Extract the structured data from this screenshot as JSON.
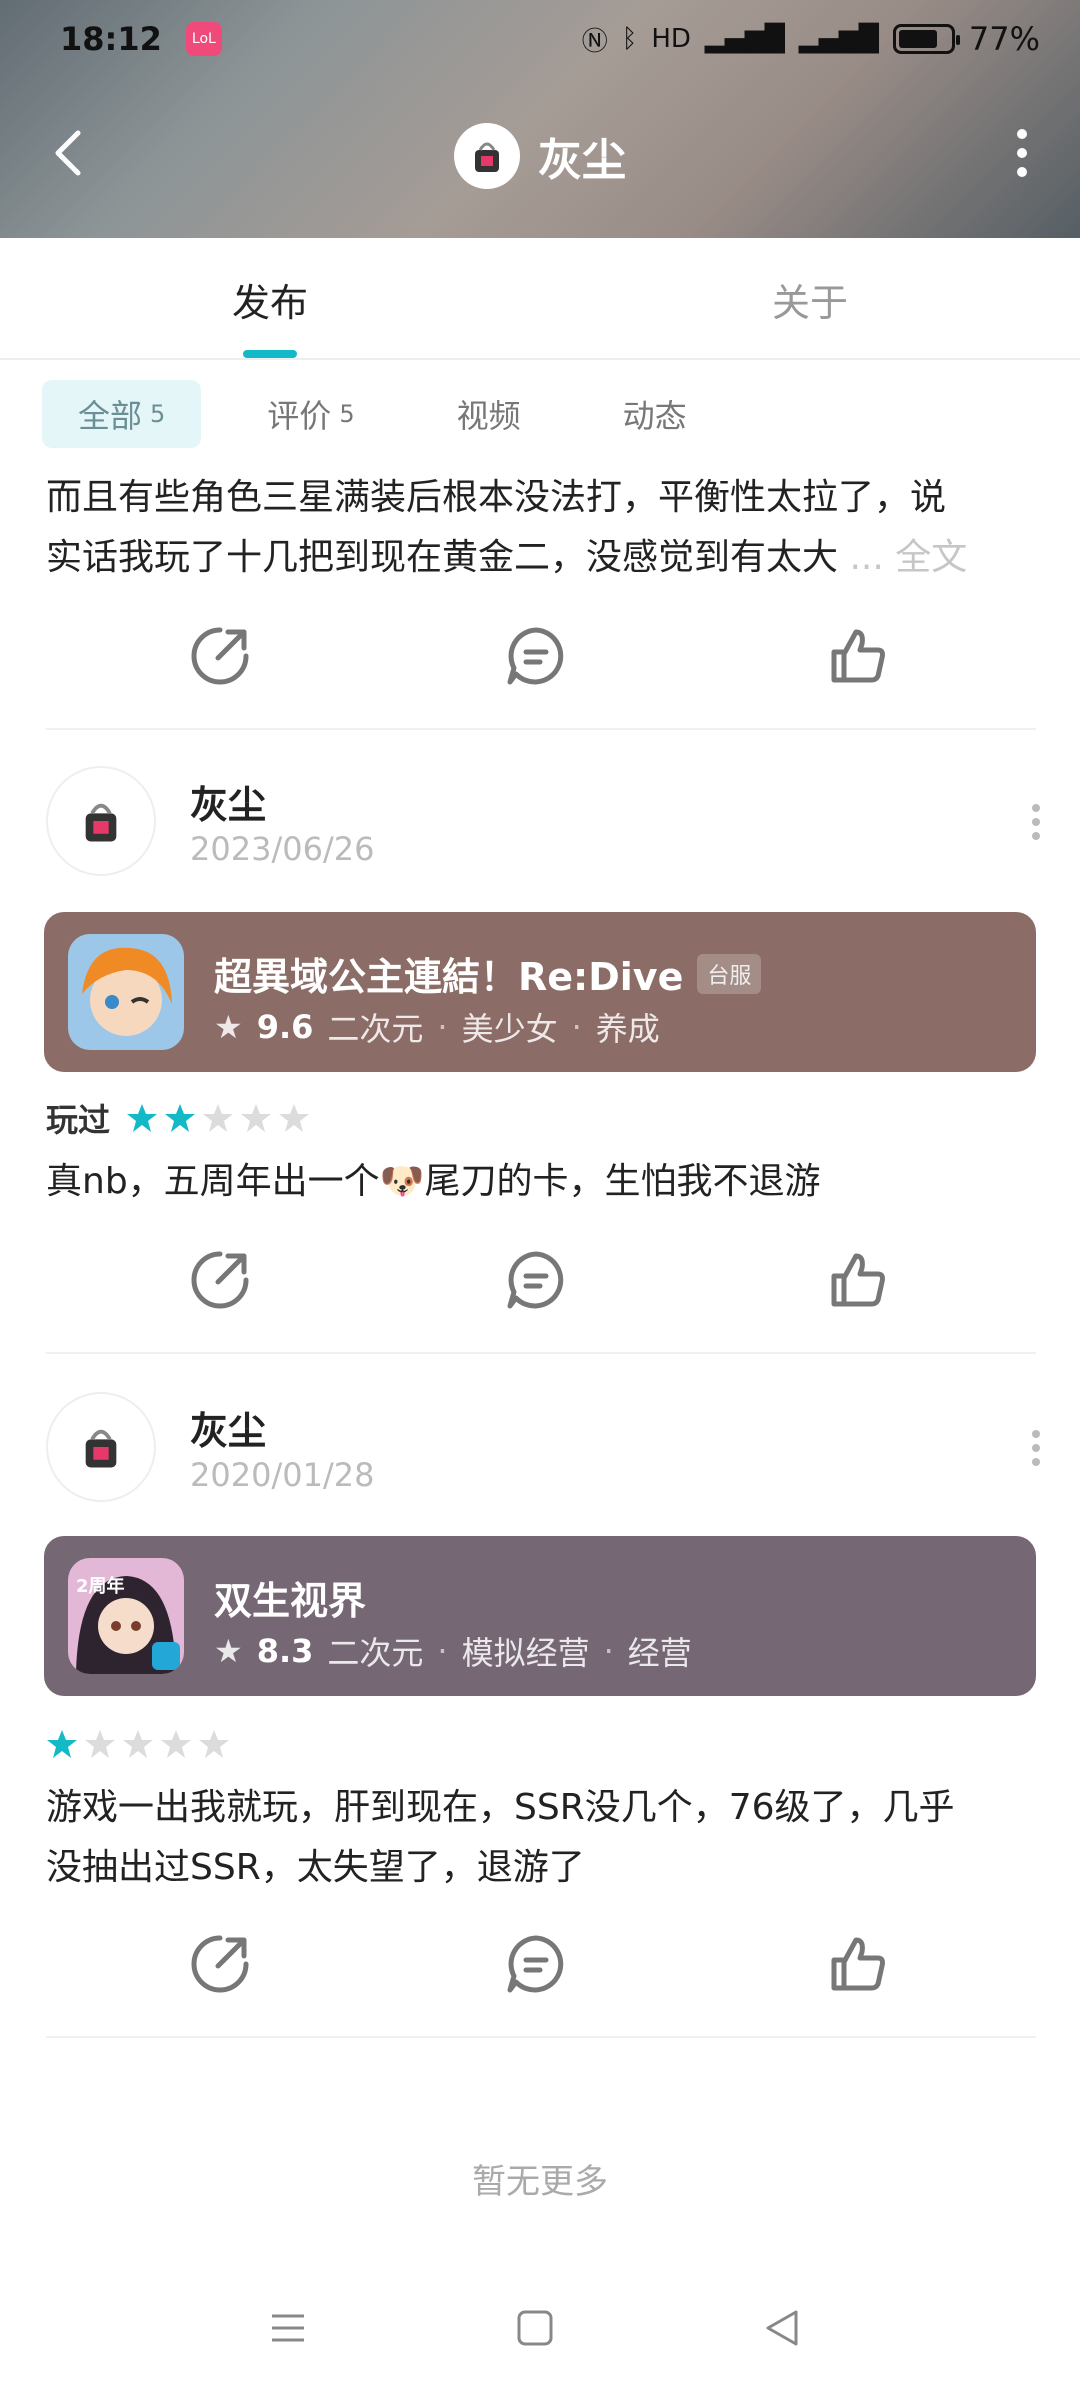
{
  "status_bar": {
    "time": "18:12",
    "app_badge": "LoL",
    "battery_pct": "77%",
    "battery_level": 0.77
  },
  "header": {
    "title": "灰尘"
  },
  "tabs": [
    {
      "label": "发布",
      "active": true
    },
    {
      "label": "关于",
      "active": false
    }
  ],
  "filters": [
    {
      "label": "全部",
      "count": "5",
      "active": true
    },
    {
      "label": "评价",
      "count": "5",
      "active": false
    },
    {
      "label": "视频",
      "count": "",
      "active": false
    },
    {
      "label": "动态",
      "count": "",
      "active": false
    }
  ],
  "first_post": {
    "text_line1": "而且有些角色三星满装后根本没法打，平衡性太拉了，说",
    "text_line2": "实话我玩了十几把到现在黄金二，没感觉到有太大",
    "more_label": "... 全文"
  },
  "reviews": [
    {
      "user": "灰尘",
      "date": "2023/06/26",
      "game": {
        "name": "超異域公主連結！Re:Dive",
        "region": "台服",
        "score": "9.6",
        "tags": [
          "二次元",
          "美少女",
          "养成"
        ],
        "card_color": "#8b6c66"
      },
      "rating_label": "玩过",
      "stars": 2,
      "text": "真nb，五周年出一个🐶尾刀的卡，生怕我不退游"
    },
    {
      "user": "灰尘",
      "date": "2020/01/28",
      "game": {
        "name": "双生视界",
        "region": "",
        "score": "8.3",
        "tags": [
          "二次元",
          "模拟经营",
          "经营"
        ],
        "card_color": "#756874"
      },
      "rating_label": "",
      "stars": 1,
      "text_line1": "游戏一出我就玩，肝到现在，SSR没几个，76级了，几乎",
      "text_line2": "没抽出过SSR，太失望了，退游了"
    }
  ],
  "footer": {
    "no_more": "暂无更多"
  },
  "colors": {
    "accent": "#14b9c8",
    "star_empty": "#dcdcdc"
  }
}
